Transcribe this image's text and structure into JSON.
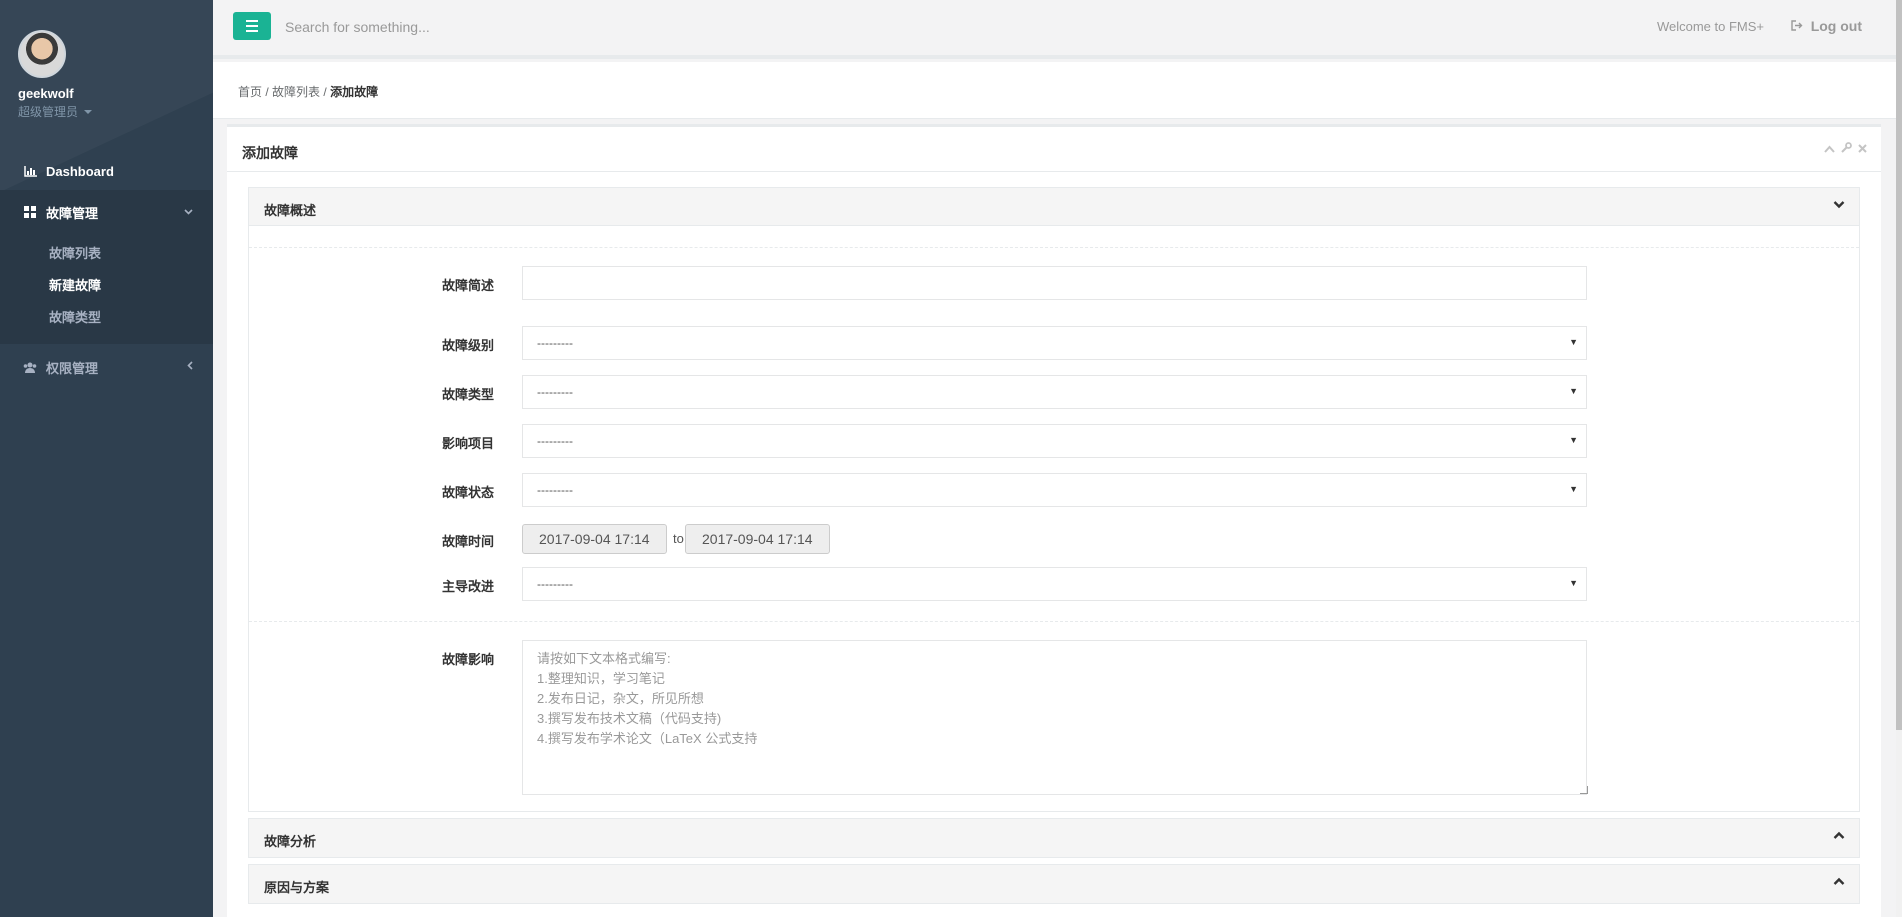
{
  "sidebar": {
    "user_name": "geekwolf",
    "user_role": "超级管理员",
    "nav": {
      "dashboard": "Dashboard",
      "fault_mgmt": "故障管理",
      "sub_items": [
        "故障列表",
        "新建故障",
        "故障类型"
      ],
      "perm_mgmt": "权限管理"
    }
  },
  "topbar": {
    "search_placeholder": "Search for something...",
    "welcome": "Welcome to FMS+",
    "logout": "Log out"
  },
  "breadcrumb": {
    "home": "首页",
    "list": "故障列表",
    "current": "添加故障",
    "sep": "/"
  },
  "main": {
    "title": "添加故障",
    "panel_overview": "故障概述",
    "panel_analysis": "故障分析",
    "panel_cause": "原因与方案",
    "fields": {
      "summary_label": "故障简述",
      "summary_value": "",
      "level_label": "故障级别",
      "level_value": "---------",
      "type_label": "故障类型",
      "type_value": "---------",
      "project_label": "影响项目",
      "project_value": "---------",
      "status_label": "故障状态",
      "status_value": "---------",
      "time_label": "故障时间",
      "time_start": "2017-09-04 17:14",
      "time_to": "to",
      "time_end": "2017-09-04 17:14",
      "improve_label": "主导改进",
      "improve_value": "---------",
      "impact_label": "故障影响",
      "impact_placeholder": "请按如下文本格式编写:\n1.整理知识，学习笔记\n2.发布日记，杂文，所见所想\n3.撰写发布技术文稿（代码支持)\n4.撰写发布学术论文（LaTeX 公式支持"
    }
  },
  "colors": {
    "sidebar_bg": "#2f4050",
    "accent": "#1ab394"
  }
}
